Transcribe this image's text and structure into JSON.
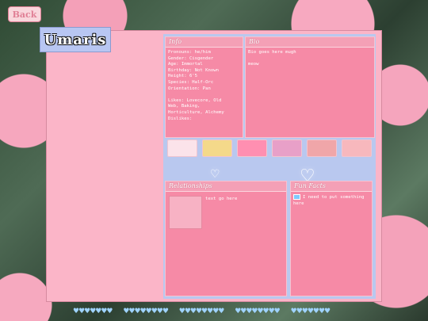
{
  "back_button": {
    "label": "Back"
  },
  "profile": {
    "name": "Umaris"
  },
  "info": {
    "heading": "Info",
    "lines": [
      "Pronouns: he/him",
      "Gender: Cisgender",
      "Age: Immortal",
      "Birthday: Not Known",
      "Height: 6'5",
      "Species: Half-Orc",
      "Orientation: Pan",
      "",
      "Likes: Lovecore, Old",
      "Web, Baking,",
      "Horticulture, Alchemy",
      "Dislikes:"
    ]
  },
  "bio": {
    "heading": "Bio",
    "lines": [
      "Bio goes here mugh",
      "",
      "meow"
    ]
  },
  "gallery": {
    "images": [
      {
        "name": "cat-thumbnail",
        "color": "#fbe3ea"
      },
      {
        "name": "bunny-thumbnail",
        "color": "#f4d98a"
      },
      {
        "name": "bedroom-thumbnail",
        "color": "#ff8fb1"
      },
      {
        "name": "anime-thumbnail",
        "color": "#e8a0c8"
      },
      {
        "name": "pixel-art-thumbnail",
        "color": "#f0a6a9"
      },
      {
        "name": "pattern-thumbnail",
        "color": "#f7b8bd"
      }
    ]
  },
  "relationships": {
    "heading": "Relationships",
    "text": "text go here"
  },
  "fun_facts": {
    "heading": "Fun Facts",
    "text": "I need to put something here"
  },
  "colors": {
    "accent": "#f68aa6",
    "panel": "#fbb5c8",
    "area": "#b9c8ef"
  }
}
